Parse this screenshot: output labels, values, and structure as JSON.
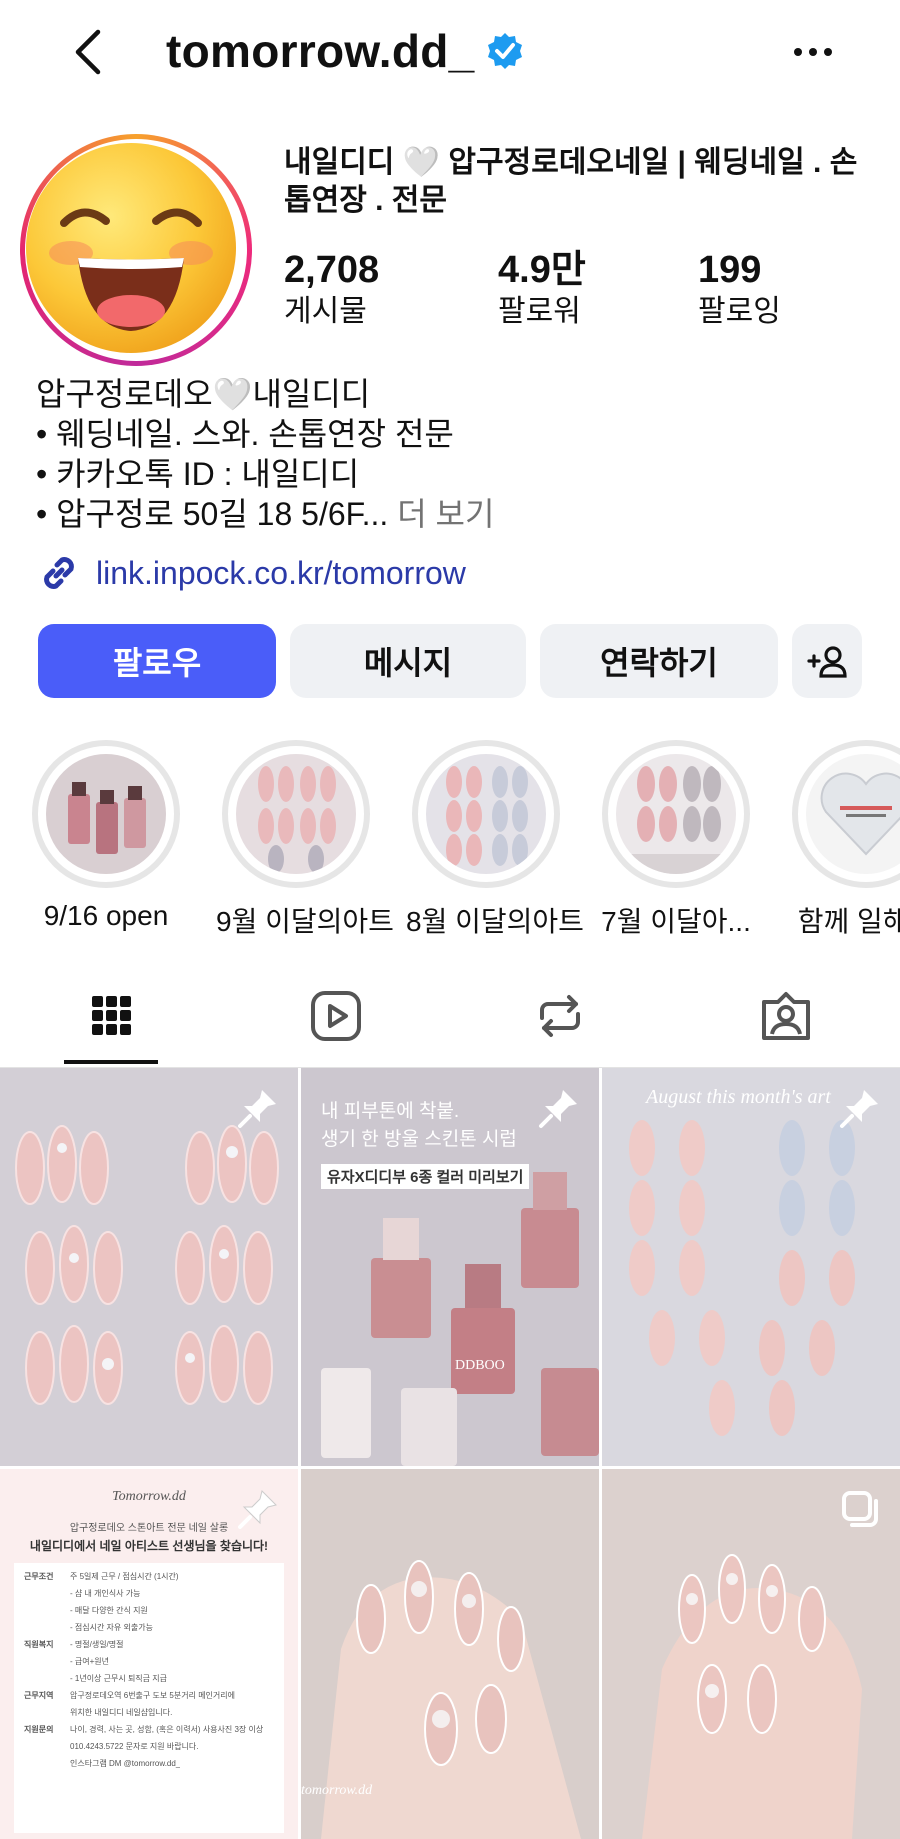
{
  "header": {
    "username": "tomorrow.dd_",
    "back_icon": "chevron-left-icon",
    "verified_icon": "verified-badge-icon",
    "more_icon": "more-horizontal-icon"
  },
  "profile": {
    "display_name": "내일디디 🤍 압구정로데오네일 | 웨딩네일 . 손톱연장 . 전문",
    "stats": [
      {
        "value": "2,708",
        "label": "게시물"
      },
      {
        "value": "4.9만",
        "label": "팔로워"
      },
      {
        "value": "199",
        "label": "팔로잉"
      }
    ],
    "bio_lines": [
      "압구정로데오🤍내일디디",
      "• 웨딩네일. 스와. 손톱연장 전문",
      "• 카카오톡 ID : 내일디디",
      "• 압구정로 50길 18 5/6F..."
    ],
    "bio_more": "더 보기",
    "link": "link.inpock.co.kr/tomorrow"
  },
  "buttons": {
    "follow": "팔로우",
    "message": "메시지",
    "contact": "연락하기",
    "add_person": "+♀"
  },
  "highlights": [
    {
      "label": "9/16 open"
    },
    {
      "label": "9월 이달의아트"
    },
    {
      "label": "8월 이달의아트"
    },
    {
      "label": "7월 이달아..."
    },
    {
      "label": "함께 일해요"
    }
  ],
  "tabs": [
    {
      "name": "grid-icon"
    },
    {
      "name": "reels-icon"
    },
    {
      "name": "repost-icon"
    },
    {
      "name": "tagged-icon"
    }
  ],
  "posts": {
    "p2_text_line1": "내 피부톤에 착붙.",
    "p2_text_line2": "생기 한 방울 스킨톤 시럽",
    "p2_tag": "유자X디디부 6종 컬러 미리보기",
    "p2_brand": "DDBOO",
    "p3_title": "August this month's art",
    "p4_brand": "Tomorrow.dd",
    "p4_sub": "압구정로데오 스톤아트 전문 네일 살롱",
    "p4_head": "내일디디에서 네일 아티스트 선생님을 찾습니다!",
    "p4_rows": [
      {
        "k": "근무조건",
        "v": "주 5일제 근무 / 점심시간 (1시간)"
      },
      {
        "k": "",
        "v": "- 샵 내 개인식사 가능"
      },
      {
        "k": "",
        "v": "- 매달 다양한 간식 지원"
      },
      {
        "k": "",
        "v": "- 점심시간 자유 외출가능"
      },
      {
        "k": "직원복지",
        "v": "- 명절/생일/명절"
      },
      {
        "k": "",
        "v": "- 급여+원년"
      },
      {
        "k": "",
        "v": "- 1년이상 근무시 퇴직금 지급"
      },
      {
        "k": "근무지역",
        "v": "압구정로데오역 6번출구 도보 5분거리 메인거리에"
      },
      {
        "k": "",
        "v": "위치한 내일디디 네일샵입니다."
      },
      {
        "k": "지원문의",
        "v": "나이, 경력, 사는 곳, 성함, (혹은 이력서) 사용사진 3장 이상"
      },
      {
        "k": "",
        "v": "010.4243.5722 문자로 지원 바랍니다."
      },
      {
        "k": "",
        "v": "인스타그램 DM @tomorrow.dd_"
      }
    ],
    "p5_watermark": "tomorrow.dd"
  }
}
